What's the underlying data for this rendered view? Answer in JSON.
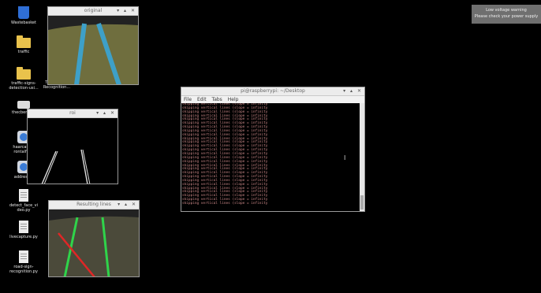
{
  "desktop": {
    "icons": [
      {
        "label": "Wastebasket",
        "icon": "trash-icon"
      },
      {
        "label": "traffic",
        "icon": "folder-icon"
      },
      {
        "label": "traffic-signs-detection-usi...",
        "icon": "folder-icon"
      },
      {
        "label": "Traffic-Sign-Recognition...",
        "icon": "document-icon"
      },
      {
        "label": "thecbem...d",
        "icon": "drive-icon"
      },
      {
        "label": "haarcasc... rontalface",
        "icon": "shortcut-icon"
      },
      {
        "label": "address...",
        "icon": "shortcut-icon"
      },
      {
        "label": "detect_face_vi deo.py",
        "icon": "document-icon"
      },
      {
        "label": "livecapture.py",
        "icon": "document-icon"
      },
      {
        "label": "road-sign-recognition.py",
        "icon": "document-icon"
      }
    ]
  },
  "windows": {
    "original": {
      "title": "original",
      "controls": "▾ ▴ ✕"
    },
    "roi": {
      "title": "roi",
      "controls": "▾ ▴ ✕"
    },
    "resulting": {
      "title": "Resulting lines",
      "controls": "▾ ▴ ✕"
    },
    "terminal": {
      "title": "pi@raspberrypi: ~/Desktop",
      "controls": "▾ ▴ ✕",
      "menu": [
        "File",
        "Edit",
        "Tabs",
        "Help"
      ],
      "lines": [
        "skipping vertical lines (slope = infinity",
        "skipping vertical lines (slope = infinity",
        "skipping vertical lines (slope = infinity",
        "skipping vertical lines (slope = infinity",
        "skipping vertical lines (slope = infinity",
        "skipping vertical lines (slope = infinity",
        "skipping vertical lines (slope = infinity",
        "skipping vertical lines (slope = infinity",
        "skipping vertical lines (slope = infinity",
        "skipping vertical lines (slope = infinity",
        "skipping vertical lines (slope = infinity",
        "skipping vertical lines (slope = infinity",
        "skipping vertical lines (slope = infinity",
        "skipping vertical lines (slope = infinity",
        "skipping vertical lines (slope = infinity",
        "skipping vertical lines (slope = infinity",
        "skipping vertical lines (slope = infinity",
        "skipping vertical lines (slope = infinity",
        "skipping vertical lines (slope = infinity",
        "skipping vertical lines (slope = infinity",
        "skipping vertical lines (slope = infinity",
        "skipping vertical lines (slope = infinity",
        "skipping vertical lines (slope = infinity",
        "skipping vertical lines (slope = infinity",
        "skipping vertical lines (slope = infinity",
        "skipping vertical lines (slope = infinity",
        "skipping vertical lines (slope = infinity"
      ]
    }
  },
  "notification": {
    "line1": "Low voltage warning",
    "line2": "Please check your power supply"
  },
  "colors": {
    "lane_blue": "#3ea0c8",
    "lane_green": "#2fd44a",
    "lane_red": "#e02626",
    "terminal_text": "#cc8888"
  }
}
